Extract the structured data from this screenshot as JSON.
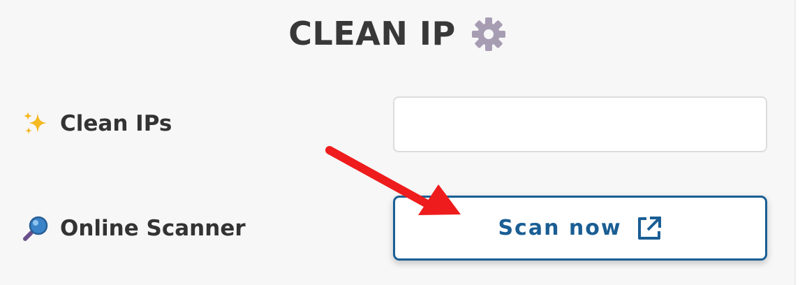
{
  "header": {
    "title": "CLEAN IP",
    "icon": "gear-icon"
  },
  "rows": {
    "clean_ips": {
      "label": "Clean IPs",
      "icon": "sparkles-icon",
      "input_value": "",
      "input_placeholder": ""
    },
    "online_scanner": {
      "label": "Online Scanner",
      "icon": "magnifier-icon",
      "button_label": "Scan now",
      "button_icon": "external-link-icon"
    }
  },
  "colors": {
    "accent": "#1a5e94",
    "annotation_arrow": "#ee1c1c",
    "gear": "#a79db3",
    "sparkles": "#f5b921",
    "magnifier": "#3a83c9"
  }
}
